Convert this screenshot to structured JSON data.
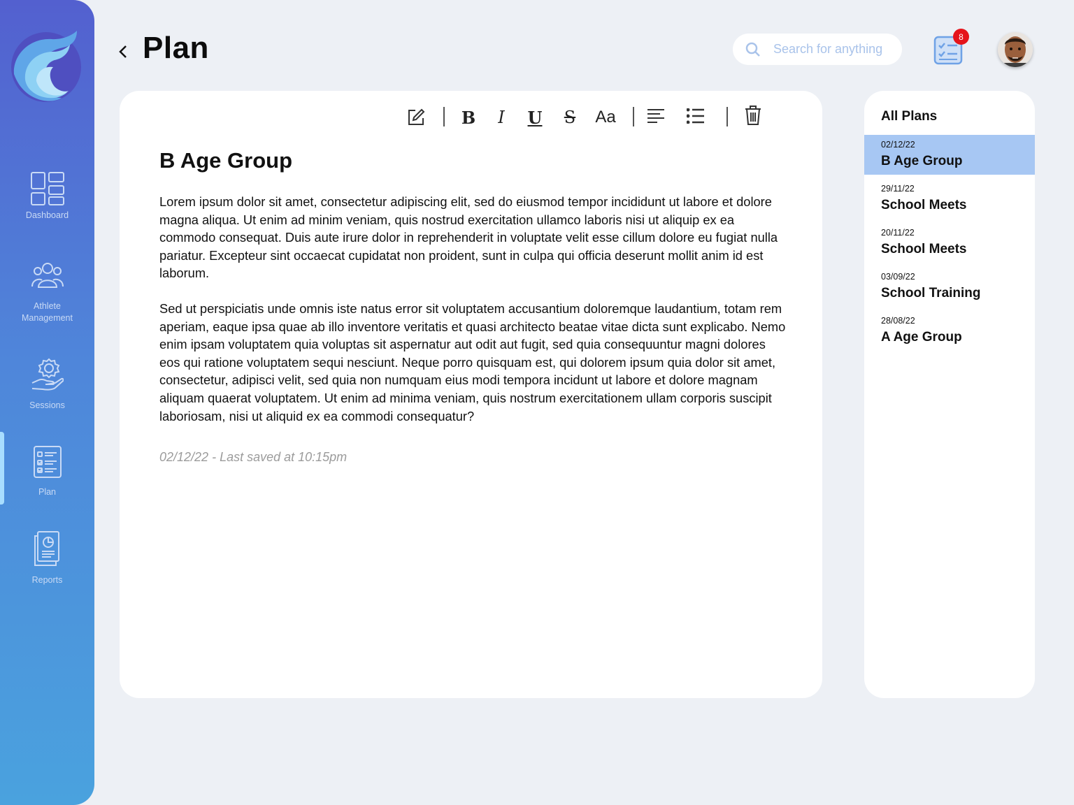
{
  "sidebar": {
    "items": [
      {
        "label": "Dashboard",
        "icon": "dashboard-grid-icon"
      },
      {
        "label": "Athlete Management",
        "icon": "people-group-icon"
      },
      {
        "label": "Sessions",
        "icon": "gear-hand-icon"
      },
      {
        "label": "Plan",
        "icon": "checklist-icon",
        "active": true
      },
      {
        "label": "Reports",
        "icon": "report-document-icon"
      }
    ]
  },
  "header": {
    "title": "Plan",
    "search_placeholder": "Search for anything",
    "notification_count": "8"
  },
  "editor": {
    "toolbar": {
      "edit": "pencil-edit-icon",
      "bold": "B",
      "italic": "I",
      "underline": "U",
      "strikethrough": "S",
      "font_size": "Aa",
      "align": "align-left-icon",
      "list": "bullet-list-icon",
      "delete": "trash-icon"
    },
    "title": "B Age Group",
    "paragraphs": [
      "Lorem ipsum dolor sit amet, consectetur adipiscing elit, sed do eiusmod tempor incididunt ut labore et dolore magna aliqua. Ut enim ad minim veniam, quis nostrud exercitation ullamco laboris nisi ut aliquip ex ea commodo consequat. Duis aute irure dolor in reprehenderit in voluptate velit esse cillum dolore eu fugiat nulla pariatur. Excepteur sint occaecat cupidatat non proident, sunt in culpa qui officia deserunt mollit anim id est laborum.",
      "Sed ut perspiciatis unde omnis iste natus error sit voluptatem accusantium doloremque laudantium, totam rem aperiam, eaque ipsa quae ab illo inventore veritatis et quasi architecto beatae vitae dicta sunt explicabo. Nemo enim ipsam voluptatem quia voluptas sit aspernatur aut odit aut fugit, sed quia consequuntur magni dolores eos qui ratione voluptatem sequi nesciunt. Neque porro quisquam est, qui dolorem ipsum quia dolor sit amet, consectetur, adipisci velit, sed quia non numquam eius modi tempora incidunt ut labore et dolore magnam aliquam quaerat voluptatem. Ut enim ad minima veniam, quis nostrum exercitationem ullam corporis suscipit laboriosam, nisi ut aliquid ex ea commodi consequatur?"
    ],
    "saved_status": "02/12/22 - Last saved at 10:15pm"
  },
  "plans": {
    "heading": "All Plans",
    "items": [
      {
        "date": "02/12/22",
        "name": "B Age Group",
        "selected": true
      },
      {
        "date": "29/11/22",
        "name": "School Meets"
      },
      {
        "date": "20/11/22",
        "name": "School Meets"
      },
      {
        "date": "03/09/22",
        "name": "School Training"
      },
      {
        "date": "28/08/22",
        "name": "A Age Group"
      }
    ]
  },
  "colors": {
    "sidebar_top": "#5360cf",
    "sidebar_bottom": "#4aa2de",
    "selected_plan": "#a7c7f3",
    "badge": "#e5141b",
    "background": "#edf0f5"
  }
}
